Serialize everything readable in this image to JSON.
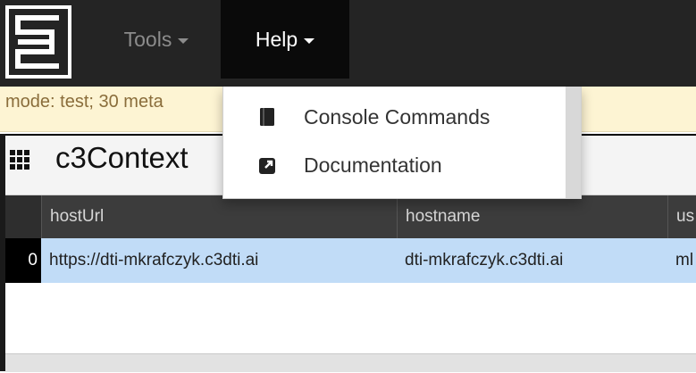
{
  "navbar": {
    "logo_icon": "c3-logo-icon",
    "tools": {
      "label": "Tools",
      "icon": "caret-down-icon"
    },
    "help": {
      "label": "Help",
      "icon": "caret-down-icon"
    }
  },
  "status": {
    "text": "mode: test; 30 meta"
  },
  "panel": {
    "title": "c3Context",
    "icon": "grid-icon"
  },
  "table": {
    "columns": [
      "hostUrl",
      "hostname",
      "us"
    ],
    "rows": [
      {
        "index": "0",
        "hostUrl": "https://dti-mkrafczyk.c3dti.ai",
        "hostname": "dti-mkrafczyk.c3dti.ai",
        "user": "ml"
      }
    ]
  },
  "help_menu": {
    "items": [
      {
        "label": "Console Commands",
        "icon": "book-icon"
      },
      {
        "label": "Documentation",
        "icon": "external-link-icon"
      }
    ]
  },
  "colors": {
    "navbar": "#242424",
    "status_bg": "#fdf4d3",
    "status_text": "#8a6d3b",
    "selected_row": "#c1dcf7",
    "table_header": "#3c3c3c"
  }
}
